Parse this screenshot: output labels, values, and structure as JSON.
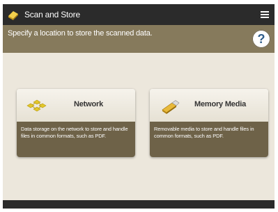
{
  "titlebar": {
    "title": "Scan and Store",
    "app_icon": "scan-store-icon",
    "menu_icon": "hamburger-menu-icon"
  },
  "instruction": {
    "text": "Specify a location to store the scanned data.",
    "help_label": "?"
  },
  "options": [
    {
      "label": "Network",
      "icon": "network-icon",
      "description": "Data storage on the network to store and handle files in common formats, such as PDF."
    },
    {
      "label": "Memory Media",
      "icon": "usb-memory-icon",
      "description": "Removable media to store and handle files in common formats, such as PDF."
    }
  ],
  "colors": {
    "titlebar": "#2b2b2b",
    "instruction_bar": "#867a5c",
    "background": "#ece7dc",
    "card_description": "#6e6248",
    "network_icon": "#e2c72a",
    "memory_icon": "#d9a521"
  }
}
